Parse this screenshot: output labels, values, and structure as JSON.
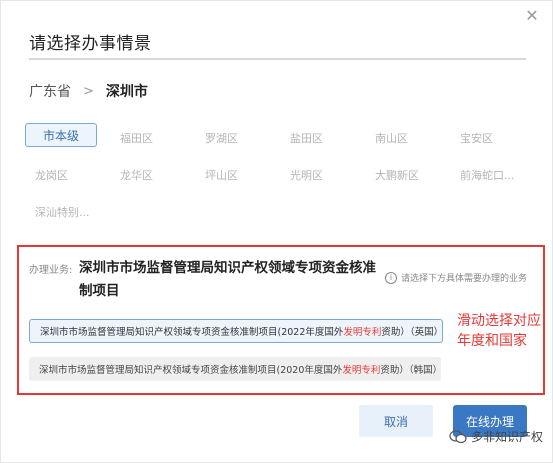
{
  "dialog": {
    "title": "请选择办事情景",
    "close_glyph": "✕"
  },
  "breadcrumb": {
    "province": "广东省",
    "separator": ">",
    "city": "深圳市"
  },
  "districts": [
    "市本级",
    "福田区",
    "罗湖区",
    "盐田区",
    "南山区",
    "宝安区",
    "龙岗区",
    "龙华区",
    "坪山区",
    "光明区",
    "大鹏新区",
    "前海蛇口...",
    "深汕特别..."
  ],
  "selected_district": "市本级",
  "business": {
    "label": "办理业务:",
    "title": "深圳市市场监督管理局知识产权领域专项资金核准制项目",
    "hint": "请选择下方具体需要办理的业务"
  },
  "options": [
    {
      "prefix": "深圳市市场监督管理局知识产权领域专项资金核准制项目(2022年度国外",
      "highlight": "发明专利",
      "suffix": "资助）（英国）",
      "selected": true
    },
    {
      "prefix": "深圳市市场监督管理局知识产权领域专项资金核准制项目(2020年度国外",
      "highlight": "发明专利",
      "suffix": "资助）（韩国）",
      "selected": false
    }
  ],
  "annotation": "滑动选择对应年度和国家",
  "buttons": {
    "cancel": "取消",
    "online": "在线办理"
  },
  "watermark": "多非知识产权",
  "colors": {
    "accent": "#3b78c4",
    "highlight": "#e53935"
  }
}
